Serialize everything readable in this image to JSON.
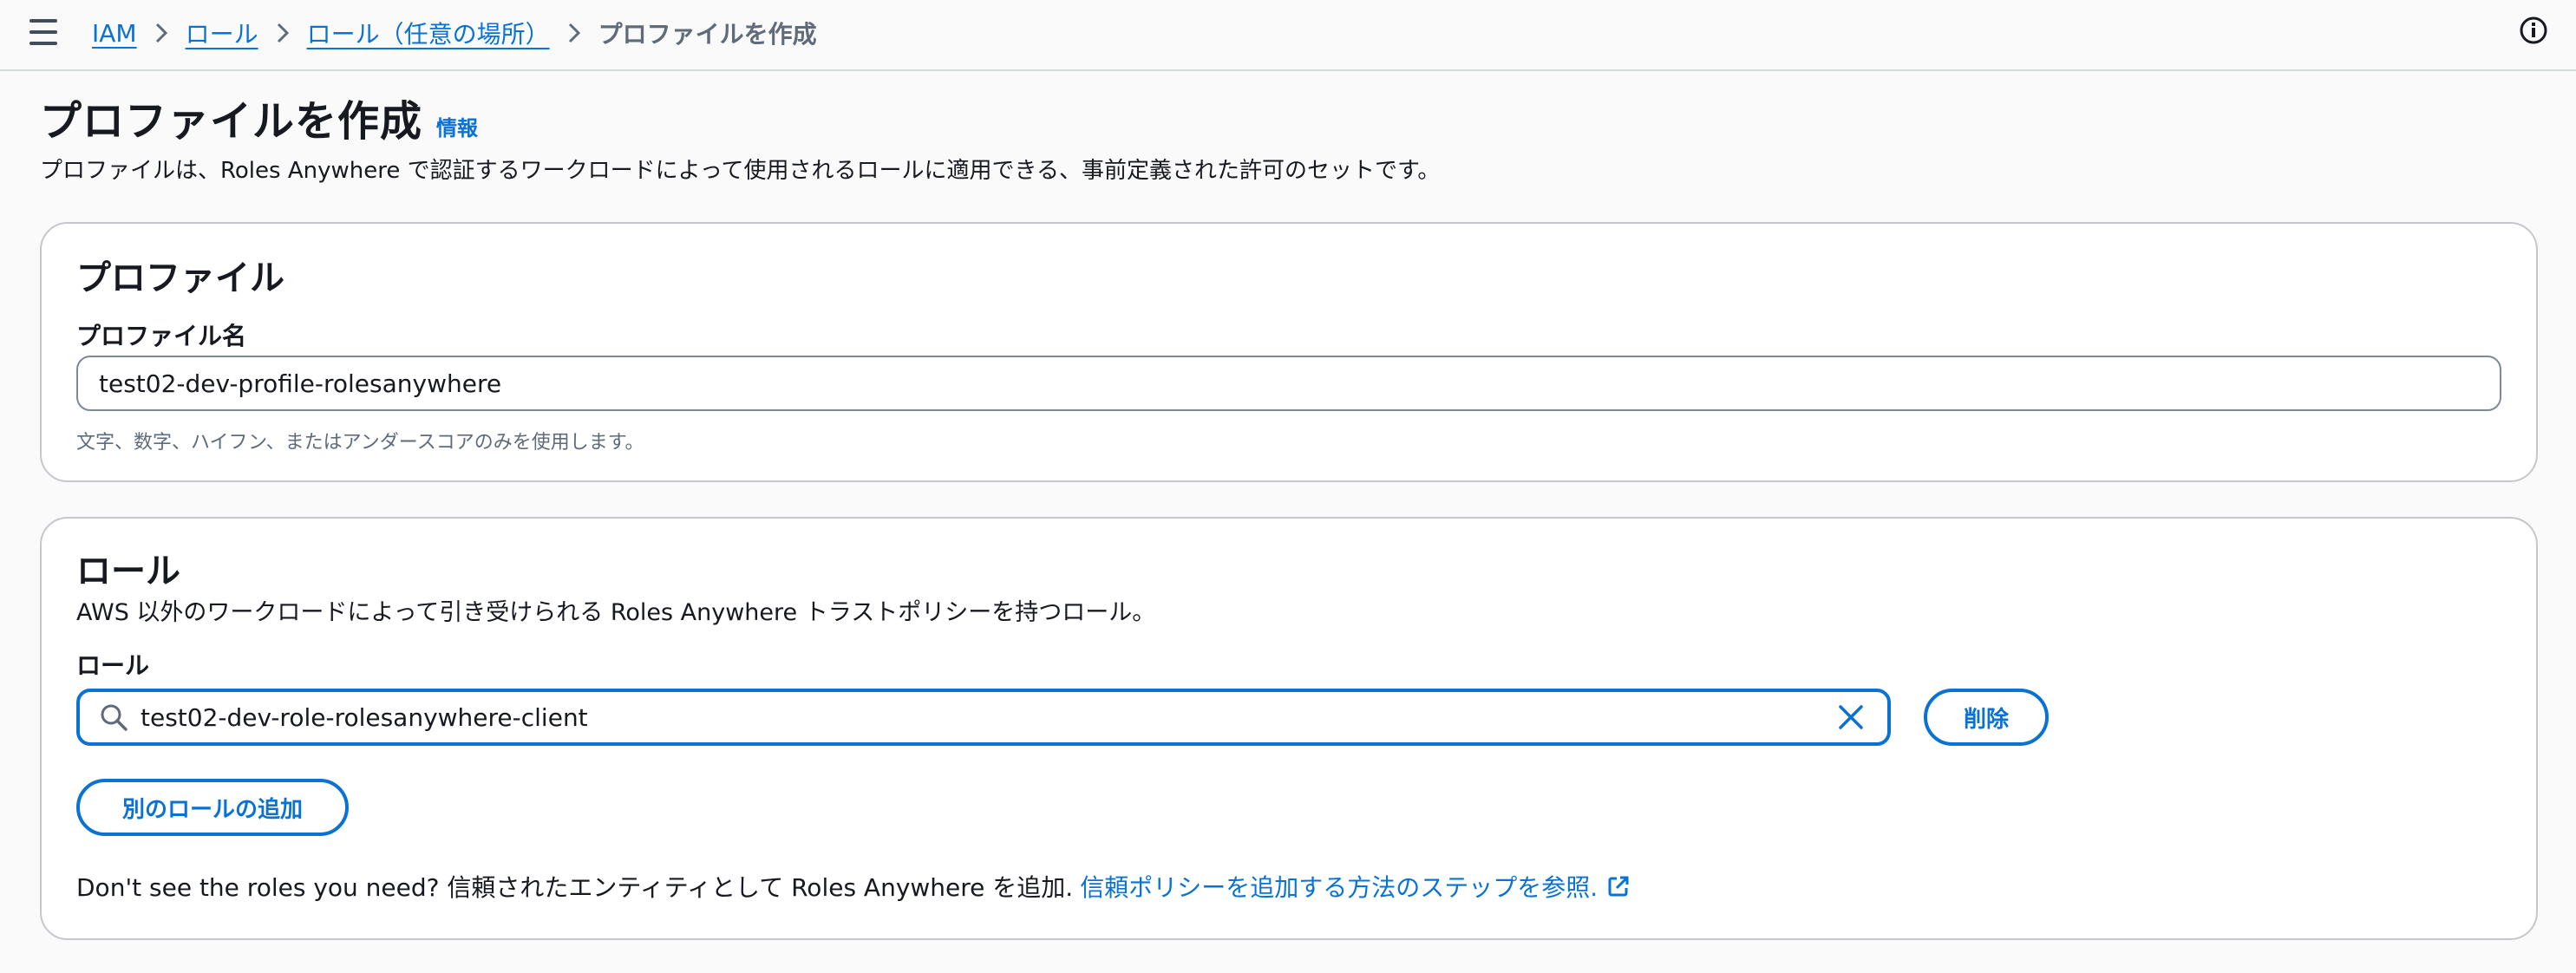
{
  "breadcrumb": {
    "items": [
      "IAM",
      "ロール",
      "ロール（任意の場所）"
    ],
    "current": "プロファイルを作成"
  },
  "header": {
    "title": "プロファイルを作成",
    "info_label": "情報",
    "description": "プロファイルは、Roles Anywhere で認証するワークロードによって使用されるロールに適用できる、事前定義された許可のセットです。"
  },
  "profile": {
    "title": "プロファイル",
    "name_label": "プロファイル名",
    "name_value": "test02-dev-profile-rolesanywhere",
    "constraint": "文字、数字、ハイフン、またはアンダースコアのみを使用します。"
  },
  "roles": {
    "title": "ロール",
    "description": "AWS 以外のワークロードによって引き受けられる Roles Anywhere トラストポリシーを持つロール。",
    "field_label": "ロール",
    "selected_role": "test02-dev-role-rolesanywhere-client",
    "remove_label": "削除",
    "add_label": "別のロールの追加",
    "footer_text": "Don't see the roles you need? 信頼されたエンティティとして Roles Anywhere を追加.",
    "footer_link": "信頼ポリシーを追加する方法のステップを参照."
  },
  "colors": {
    "link": "#0972d3",
    "text": "#16191f",
    "border": "#c6c6cd",
    "background": "#fafafa"
  },
  "icons": [
    "menu-icon",
    "chevron-right-icon",
    "info-circle-icon",
    "search-icon",
    "close-icon",
    "external-link-icon"
  ]
}
